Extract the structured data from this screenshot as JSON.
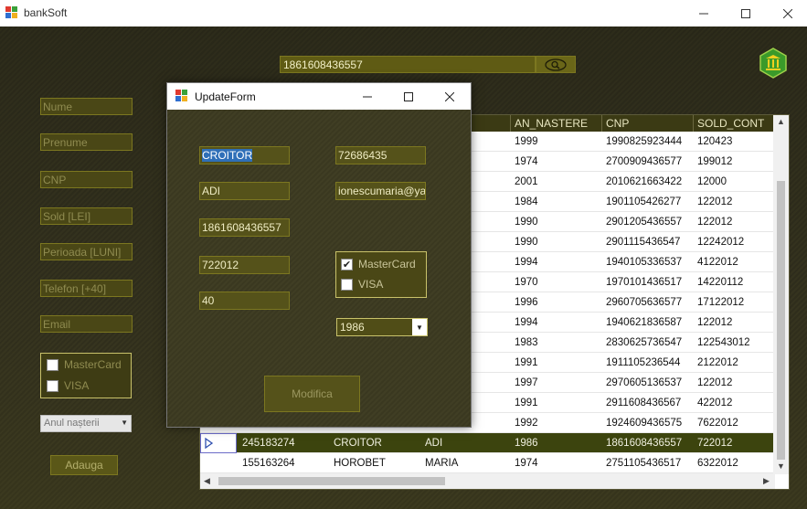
{
  "window": {
    "title": "bankSoft"
  },
  "search": {
    "value": "1861608436557"
  },
  "side_form": {
    "fields": [
      {
        "placeholder": "Nume"
      },
      {
        "placeholder": "Prenume"
      },
      {
        "placeholder": "CNP"
      },
      {
        "placeholder": "Sold [LEI]"
      },
      {
        "placeholder": "Perioada [LUNI]"
      },
      {
        "placeholder": "Telefon [+40]"
      },
      {
        "placeholder": "Email"
      }
    ],
    "mastercard_label": "MasterCard",
    "visa_label": "VISA",
    "year_select": "Anul nașterii",
    "add_label": "Adauga"
  },
  "grid": {
    "columns": [
      "E",
      "AN_NASTERE",
      "CNP",
      "SOLD_CONT"
    ],
    "rows": [
      {
        "cells": [
          "",
          "",
          "",
          "1999",
          "1990825923444",
          "120423"
        ]
      },
      {
        "cells": [
          "",
          "",
          "",
          "1974",
          "2700909436577",
          "199012"
        ]
      },
      {
        "cells": [
          "",
          "",
          "",
          "2001",
          "2010621663422",
          "12000"
        ]
      },
      {
        "cells": [
          "",
          "",
          "",
          "1984",
          "1901105426277",
          "122012"
        ]
      },
      {
        "cells": [
          "",
          "",
          "",
          "1990",
          "2901205436557",
          "122012"
        ]
      },
      {
        "cells": [
          "",
          "",
          "",
          "1990",
          "2901115436547",
          "12242012"
        ]
      },
      {
        "cells": [
          "",
          "",
          "",
          "1994",
          "1940105336537",
          "4122012"
        ]
      },
      {
        "cells": [
          "",
          "",
          "",
          "1970",
          "1970101436517",
          "14220112"
        ]
      },
      {
        "cells": [
          "",
          "",
          "",
          "1996",
          "2960705636577",
          "17122012"
        ]
      },
      {
        "cells": [
          "",
          "",
          "",
          "1994",
          "1940621836587",
          "122012"
        ]
      },
      {
        "cells": [
          "",
          "",
          "",
          "1983",
          "2830625736547",
          "122543012"
        ]
      },
      {
        "cells": [
          "",
          "",
          "",
          "1991",
          "1911105236544",
          "2122012"
        ]
      },
      {
        "cells": [
          "",
          "",
          "",
          "1997",
          "2970605136537",
          "122012"
        ]
      },
      {
        "cells": [
          "",
          "",
          "",
          "1991",
          "2911608436567",
          "422012"
        ]
      },
      {
        "cells": [
          "",
          "",
          "",
          "1992",
          "1924609436575",
          "7622012"
        ]
      },
      {
        "cells": [
          "245183274",
          "CROITOR",
          "ADI",
          "1986",
          "1861608436557",
          "722012"
        ],
        "selected": true
      },
      {
        "cells": [
          "155163264",
          "HOROBET",
          "MARIA",
          "1974",
          "2751105436517",
          "6322012"
        ]
      }
    ]
  },
  "dialog": {
    "title": "UpdateForm",
    "nume": "CROITOR",
    "telefon": "72686435",
    "prenume": "ADI",
    "email": "ionescumaria@yahoo",
    "cnp": "1861608436557",
    "sold": "722012",
    "perioada": "40",
    "mastercard_label": "MasterCard",
    "mastercard_checked": true,
    "visa_label": "VISA",
    "visa_checked": false,
    "year": "1986",
    "modify_label": "Modifica"
  },
  "colors": {
    "accent": "#5f5b14",
    "background": "#2e2c1c",
    "selected_row": "#3c440e",
    "selection_highlight": "#2f6fb8"
  }
}
